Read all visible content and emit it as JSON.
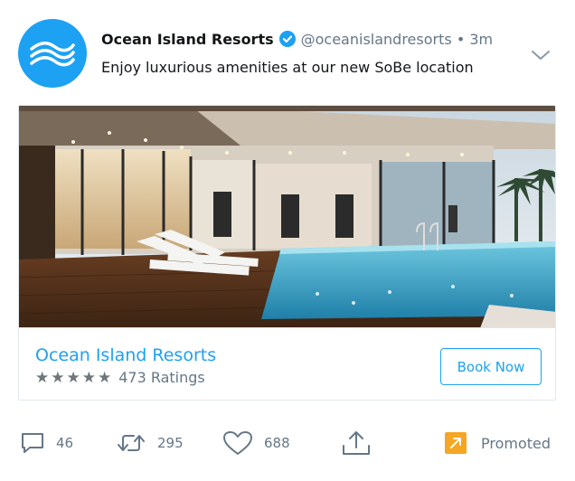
{
  "tweet": {
    "author_name": "Ocean Island Resorts",
    "handle": "@oceanislandresorts",
    "separator": "•",
    "time": "3m",
    "text": "Enjoy luxurious amenities at our new SoBe location"
  },
  "card": {
    "title": "Ocean Island Resorts",
    "stars": "★★★★★",
    "rating_label": "473 Ratings",
    "button_label": "Book Now"
  },
  "actions": {
    "replies": "46",
    "retweets": "295",
    "likes": "688",
    "promoted_label": "Promoted"
  },
  "colors": {
    "accent": "#1da1f2",
    "promoted": "#f5a623",
    "muted": "#657786"
  },
  "icons": [
    "waves-logo-icon",
    "verified-badge-icon",
    "chevron-down-icon",
    "reply-icon",
    "retweet-icon",
    "like-icon",
    "share-icon",
    "promoted-icon"
  ]
}
